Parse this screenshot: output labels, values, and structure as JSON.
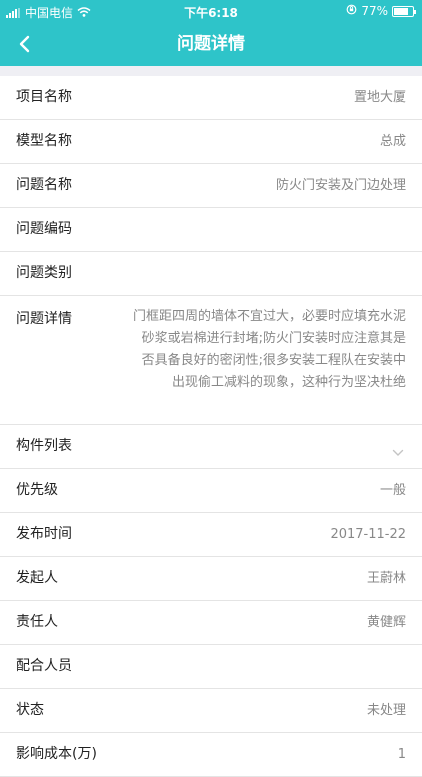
{
  "status_bar": {
    "carrier": "中国电信",
    "time": "下午6:18",
    "battery_percent": "77%",
    "battery_level": 0.77
  },
  "nav": {
    "title": "问题详情",
    "back_icon": "chevron-left-icon"
  },
  "colors": {
    "accent": "#2ec4c9",
    "label": "#222222",
    "value": "#888888",
    "divider": "#e4e4e4",
    "section_bg": "#efeff4"
  },
  "fields": {
    "project_name": {
      "label": "项目名称",
      "value": "置地大厦"
    },
    "model_name": {
      "label": "模型名称",
      "value": "总成"
    },
    "issue_name": {
      "label": "问题名称",
      "value": "防火门安装及门边处理"
    },
    "issue_code": {
      "label": "问题编码",
      "value": ""
    },
    "issue_category": {
      "label": "问题类别",
      "value": ""
    },
    "issue_detail": {
      "label": "问题详情",
      "value": "门框距四周的墙体不宜过大，必要时应填充水泥砂浆或岩棉进行封堵;防火门安装时应注意其是否具备良好的密闭性;很多安装工程队在安装中出现偷工减料的现象，这种行为坚决杜绝"
    },
    "component_list": {
      "label": "构件列表",
      "icon": "chevron-down-icon"
    },
    "priority": {
      "label": "优先级",
      "value": "一般"
    },
    "publish_time": {
      "label": "发布时间",
      "value": "2017-11-22"
    },
    "initiator": {
      "label": "发起人",
      "value": "王蔚林"
    },
    "responsible": {
      "label": "责任人",
      "value": "黄健辉"
    },
    "cooperators": {
      "label": "配合人员",
      "value": ""
    },
    "status": {
      "label": "状态",
      "value": "未处理"
    },
    "cost_impact": {
      "label": "影响成本(万)",
      "value": "1"
    }
  }
}
